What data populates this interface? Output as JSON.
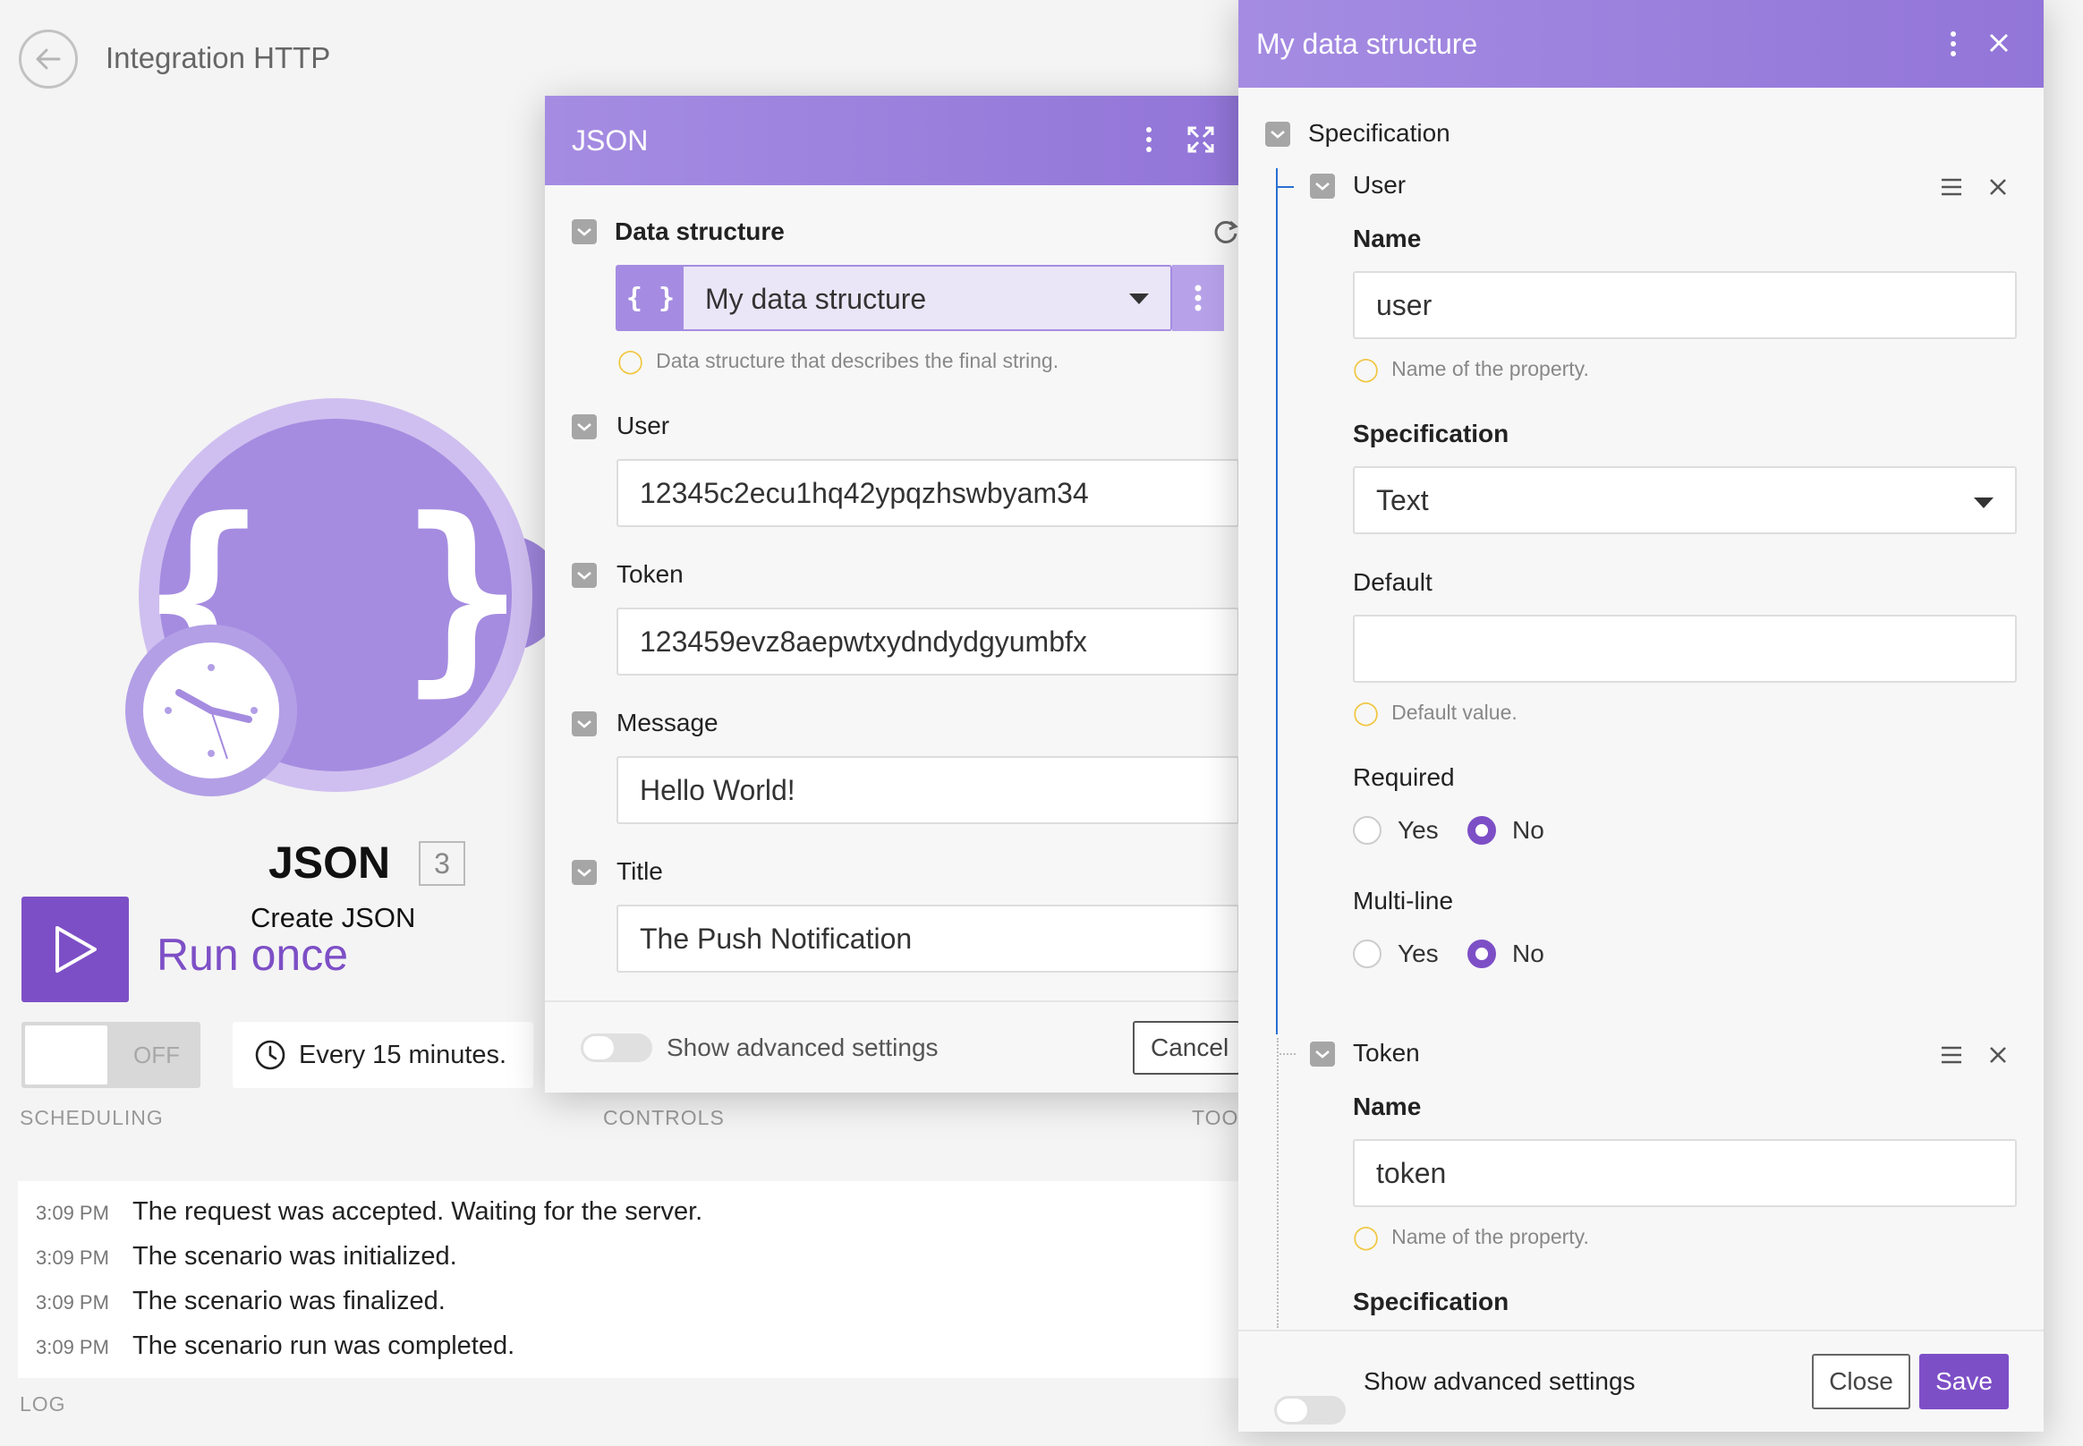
{
  "scenario": {
    "title": "Integration HTTP",
    "module_name": "JSON",
    "module_badge": "3",
    "module_subtitle": "Create JSON",
    "run_label": "Run once",
    "toggle_state": "OFF",
    "schedule_text": "Every 15 minutes.",
    "sections": {
      "scheduling": "SCHEDULING",
      "controls": "CONTROLS",
      "tools": "TOO",
      "log": "LOG"
    }
  },
  "log": [
    {
      "time": "3:09 PM",
      "text": "The request was accepted. Waiting for the server."
    },
    {
      "time": "3:09 PM",
      "text": "The scenario was initialized."
    },
    {
      "time": "3:09 PM",
      "text": "The scenario was finalized."
    },
    {
      "time": "3:09 PM",
      "text": "The scenario run was completed."
    }
  ],
  "json_dialog": {
    "title": "JSON",
    "data_structure_label": "Data structure",
    "data_structure_value": "My data structure",
    "data_structure_hint": "Data structure that describes the final string.",
    "fields": [
      {
        "label": "User",
        "value": "12345c2ecu1hq42ypqzhswbyam34"
      },
      {
        "label": "Token",
        "value": "123459evz8aepwtxydndydgyumbfx"
      },
      {
        "label": "Message",
        "value": "Hello World!"
      },
      {
        "label": "Title",
        "value": "The Push Notification"
      }
    ],
    "advanced_label": "Show advanced settings",
    "cancel_label": "Cancel"
  },
  "ds_dialog": {
    "title": "My data structure",
    "spec_label": "Specification",
    "user_item": {
      "label": "User",
      "name_label": "Name",
      "name_value": "user",
      "name_hint": "Name of the property.",
      "spec_label": "Specification",
      "spec_value": "Text",
      "default_label": "Default",
      "default_value": "",
      "default_hint": "Default value.",
      "required_label": "Required",
      "multiline_label": "Multi-line",
      "yes_label": "Yes",
      "no_label": "No"
    },
    "token_item": {
      "label": "Token",
      "name_label": "Name",
      "name_value": "token",
      "name_hint": "Name of the property.",
      "spec_label": "Specification"
    },
    "advanced_label": "Show advanced settings",
    "close_label": "Close",
    "save_label": "Save"
  },
  "colors": {
    "accent": "#7d4fc6",
    "header": "#a58ce2",
    "tree_line": "#2a6fd1",
    "hint_bulb": "#f0c640"
  },
  "icons": {
    "back": "arrow-left-icon",
    "module": "json-braces-icon",
    "clock": "clock-icon",
    "play": "play-icon",
    "menu": "kebab-menu-icon",
    "expand": "expand-icon",
    "close": "close-icon",
    "refresh": "refresh-icon",
    "drag": "drag-handle-icon",
    "bulb": "lightbulb-icon"
  }
}
